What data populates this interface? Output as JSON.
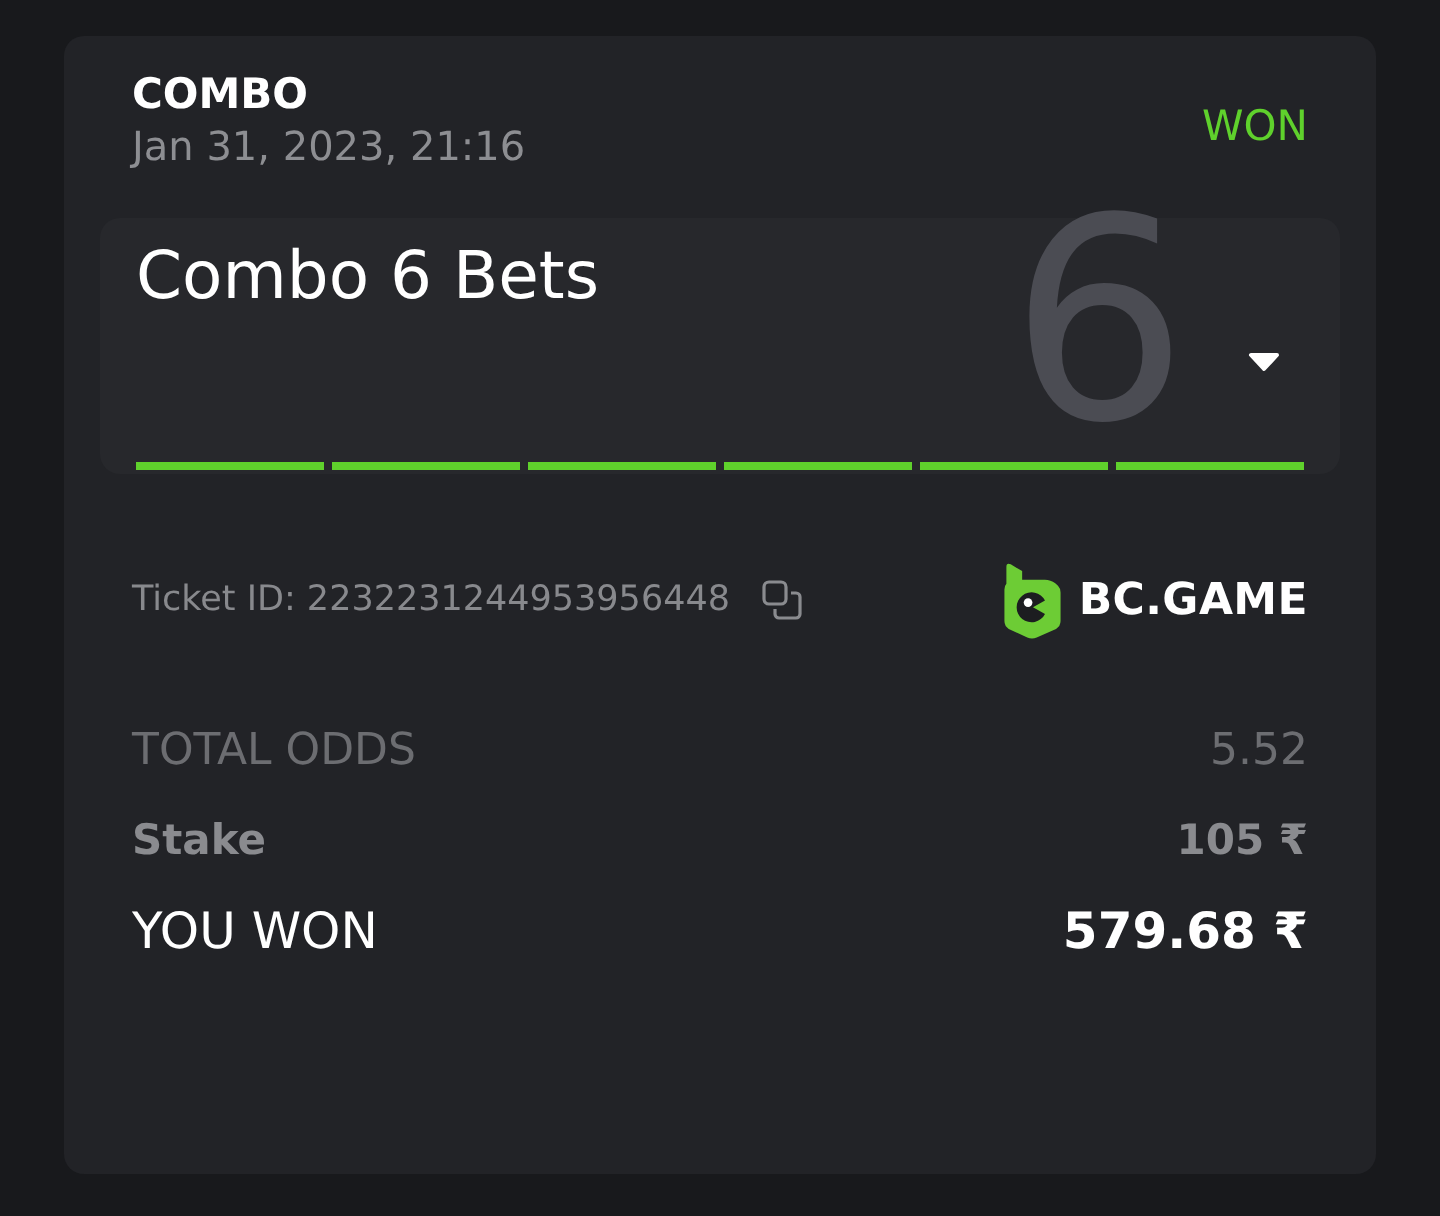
{
  "header": {
    "bet_type": "COMBO",
    "date": "Jan 31, 2023, 21:16",
    "status": {
      "text": "WON",
      "won": true
    }
  },
  "combo": {
    "title": "Combo 6 Bets",
    "count": "6",
    "expanded": false,
    "legs": [
      {
        "won": true
      },
      {
        "won": true
      },
      {
        "won": true
      },
      {
        "won": true
      },
      {
        "won": true
      },
      {
        "won": true
      }
    ]
  },
  "ticket": {
    "text": "Ticket ID: 2232231244953956448"
  },
  "brand": {
    "name": "BC.GAME"
  },
  "summary": [
    {
      "kind": "odds",
      "label": "TOTAL ODDS",
      "value": "5.52"
    },
    {
      "kind": "stake",
      "label": "Stake",
      "value": "105 ₹"
    },
    {
      "kind": "payout",
      "label": "YOU WON",
      "value": "579.68 ₹"
    }
  ]
}
